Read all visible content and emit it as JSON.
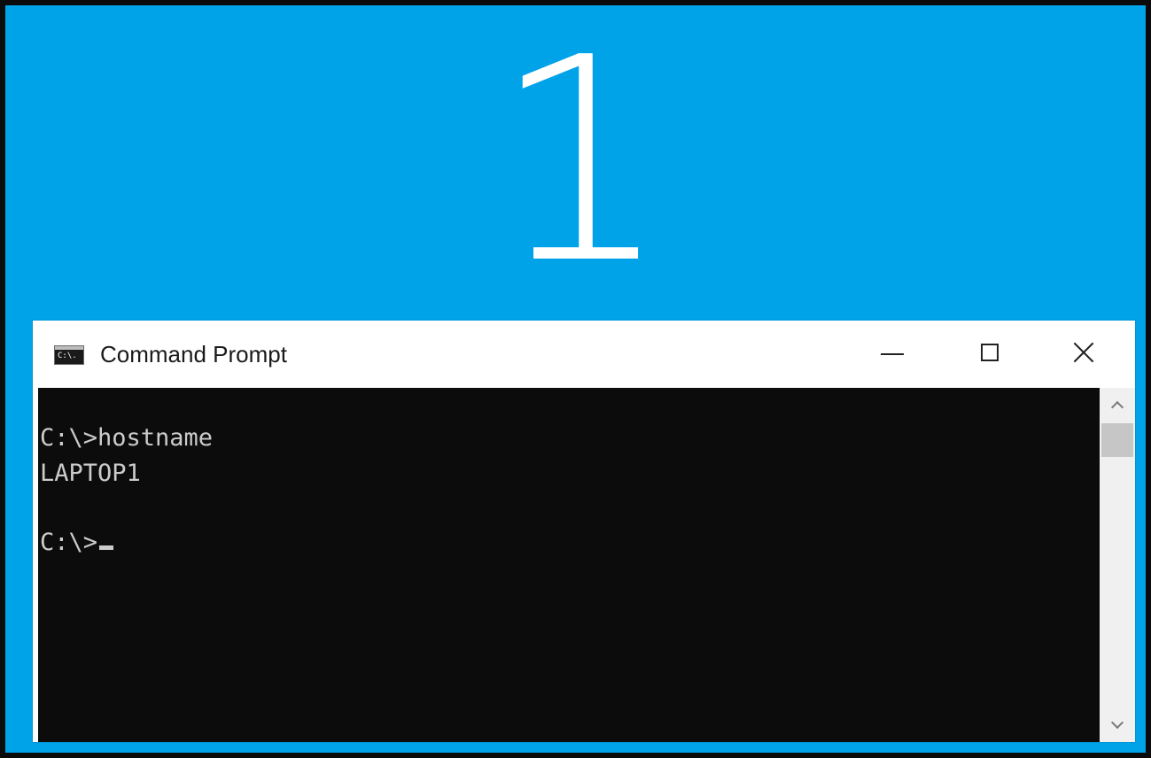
{
  "desktop": {
    "display_number": "1",
    "background_color": "#00a2e8"
  },
  "window": {
    "title": "Command Prompt",
    "icon": "cmd-icon",
    "icon_text": "C:\\.",
    "controls": {
      "minimize": "minimize-icon",
      "maximize": "maximize-icon",
      "close": "close-icon"
    }
  },
  "console": {
    "lines": [
      "C:\\>hostname",
      "LAPTOP1",
      "C:\\>"
    ],
    "text_color": "#cccccc",
    "background_color": "#0c0c0c"
  },
  "scrollbar": {
    "up": "chevron-up-icon",
    "down": "chevron-down-icon"
  }
}
